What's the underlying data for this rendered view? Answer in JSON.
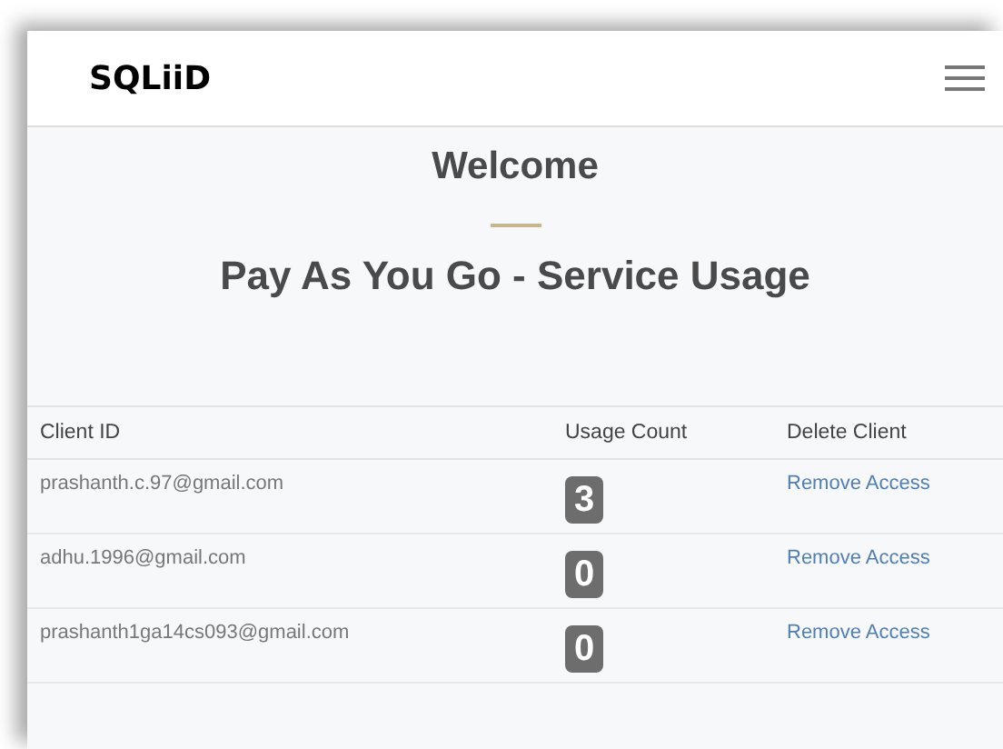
{
  "brand": "SQLiiD",
  "welcome": "Welcome",
  "title": "Pay As You Go - Service Usage",
  "table": {
    "columns": [
      "Client ID",
      "Usage Count",
      "Delete Client"
    ],
    "rows": [
      {
        "client": "prashanth.c.97@gmail.com",
        "count": "3",
        "action": "Remove Access"
      },
      {
        "client": "adhu.1996@gmail.com",
        "count": "0",
        "action": "Remove Access"
      },
      {
        "client": "prashanth1ga14cs093@gmail.com",
        "count": "0",
        "action": "Remove Access"
      }
    ]
  }
}
